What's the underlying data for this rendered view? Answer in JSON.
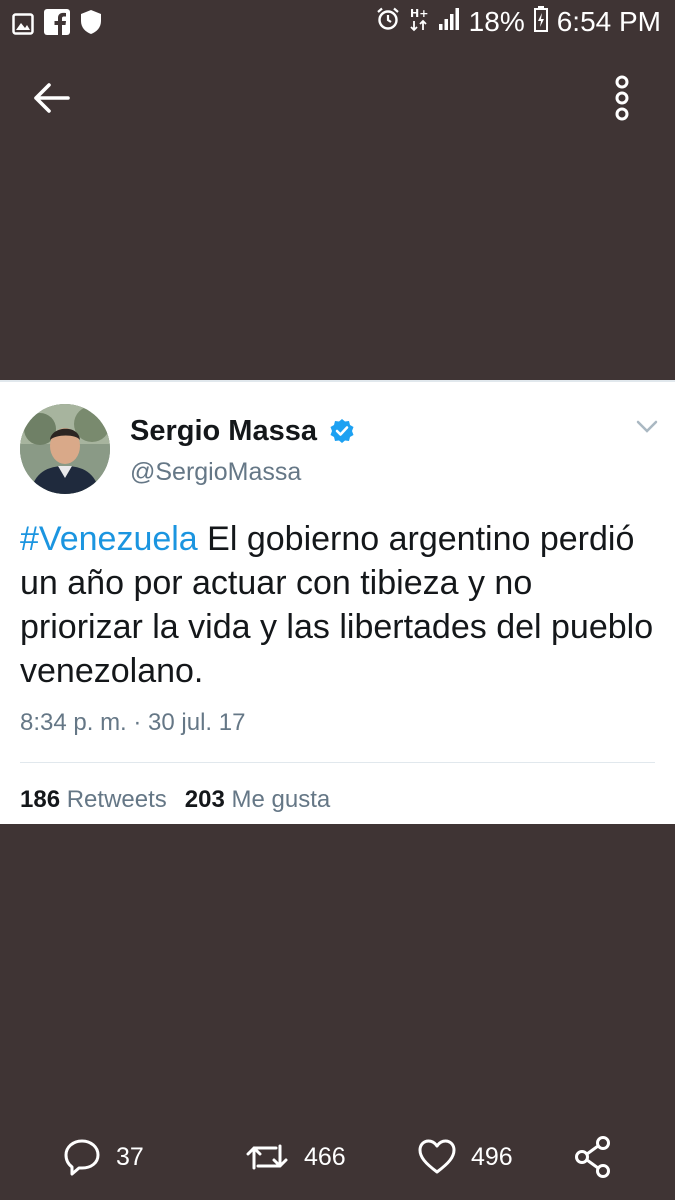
{
  "status_bar": {
    "battery": "18%",
    "time": "6:54 PM",
    "left_icons": [
      "image-icon",
      "facebook-icon",
      "shield-icon"
    ],
    "right_icons": [
      "alarm-icon",
      "hplus-icon",
      "signal-icon",
      "battery-icon"
    ]
  },
  "toolbar": {
    "back_icon": "arrow-left-icon",
    "more_icon": "more-vertical-icon"
  },
  "tweet": {
    "author_name": "Sergio Massa",
    "handle": "@SergioMassa",
    "hashtag": "#Venezuela",
    "text": " El gobierno argentino perdió un año por actuar con tibieza y no priorizar la vida y las libertades del pueblo venezolano.",
    "timestamp": "8:34 p. m. · 30 jul. 17",
    "retweets_count": "186",
    "retweets_label": "Retweets",
    "likes_count": "203",
    "likes_label": "Me gusta"
  },
  "actions": {
    "replies": "37",
    "retweets": "466",
    "likes": "496"
  },
  "colors": {
    "background": "#3f3434",
    "link": "#1b95e0",
    "verified": "#1da1f2",
    "muted": "#657786"
  }
}
